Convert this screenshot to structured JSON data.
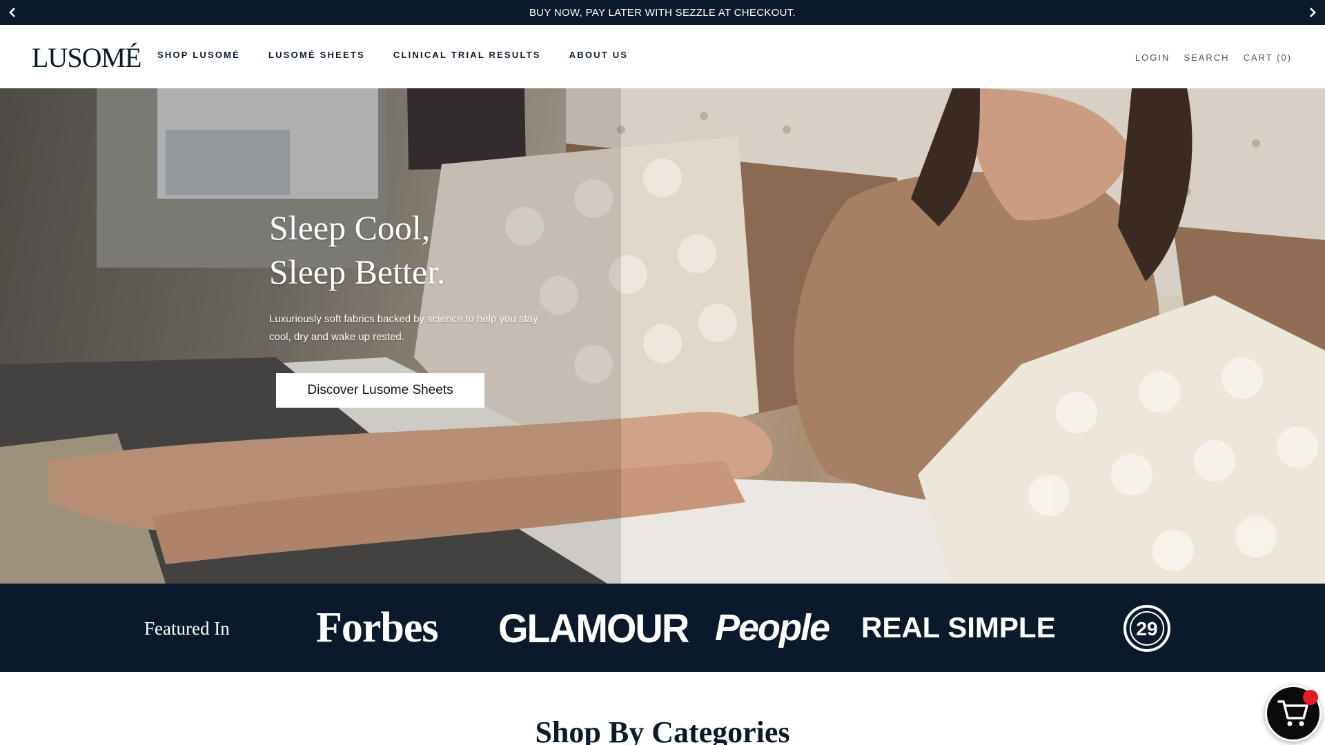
{
  "announcement": {
    "message": "BUY NOW, PAY LATER WITH SEZZLE AT CHECKOUT.",
    "prev_icon": "chevron-left-icon",
    "next_icon": "chevron-right-icon"
  },
  "header": {
    "logo": "LUSOMÉ",
    "nav": [
      {
        "label": "SHOP LUSOMÉ"
      },
      {
        "label": "LUSOMÉ SHEETS"
      },
      {
        "label": "CLINICAL TRIAL RESULTS"
      },
      {
        "label": "ABOUT US"
      }
    ],
    "utility": {
      "login": "LOGIN",
      "search": "SEARCH",
      "cart": "CART (0)"
    }
  },
  "hero": {
    "title_line1": "Sleep Cool,",
    "title_line2": "Sleep Better.",
    "subtitle": "Luxuriously soft fabrics backed by science to help you stay cool, dry and wake up rested.",
    "cta": "Discover Lusome Sheets"
  },
  "featured": {
    "label": "Featured In",
    "press": [
      "Forbes",
      "GLAMOUR",
      "People",
      "REAL SIMPLE",
      "29"
    ]
  },
  "section": {
    "title": "Shop By Categories"
  },
  "floating_cart": {
    "icon": "shopping-cart-icon",
    "badge_color": "#e31b23"
  },
  "colors": {
    "navy": "#0b1a2b",
    "white": "#ffffff"
  }
}
